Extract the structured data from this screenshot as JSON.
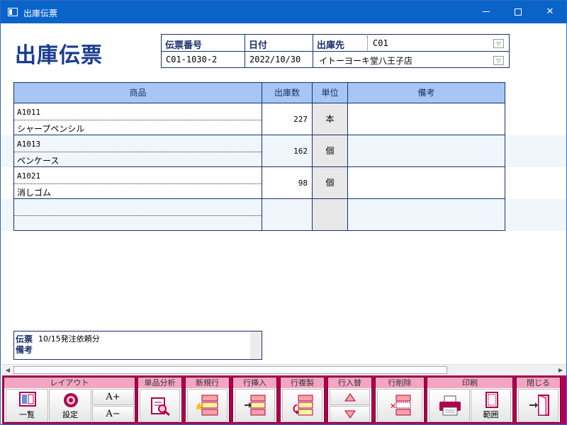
{
  "window": {
    "title": "出庫伝票"
  },
  "heading": "出庫伝票",
  "header": {
    "slip_no_label": "伝票番号",
    "slip_no": "C01-1030-2",
    "date_label": "日付",
    "date": "2022/10/30",
    "dest_label": "出庫先",
    "dest_code": "C01",
    "dest_name": "イトーヨーキ堂八王子店"
  },
  "grid": {
    "columns": [
      "商品",
      "出庫数",
      "単位",
      "備考"
    ],
    "rows": [
      {
        "code": "A1011",
        "name": "シャープペンシル",
        "qty": "227",
        "unit": "本",
        "note": ""
      },
      {
        "code": "A1013",
        "name": "ペンケース",
        "qty": "162",
        "unit": "個",
        "note": ""
      },
      {
        "code": "A1021",
        "name": "消しゴム",
        "qty": "98",
        "unit": "個",
        "note": ""
      },
      {
        "code": "",
        "name": "",
        "qty": "",
        "unit": "",
        "note": ""
      }
    ]
  },
  "memo": {
    "label": "伝票備考",
    "text": "10/15発注依頼分"
  },
  "toolbar": {
    "layout_group": "レイアウト",
    "list_label": "一覧",
    "settings_label": "設定",
    "font_up": "A+",
    "font_down": "A−",
    "product_analysis": "単品分析",
    "new_row": "新規行",
    "insert_row": "行挿入",
    "copy_row": "行複製",
    "swap_row": "行入替",
    "delete_row": "行削除",
    "print_group": "印刷",
    "range_label": "範囲",
    "close": "閉じる"
  },
  "colors": {
    "titlebar": "#0a63c9",
    "accent": "#1b3c8f",
    "grid_header": "#a7c6f5",
    "toolbar": "#b0004f",
    "group_header": "#f3a6c1"
  }
}
